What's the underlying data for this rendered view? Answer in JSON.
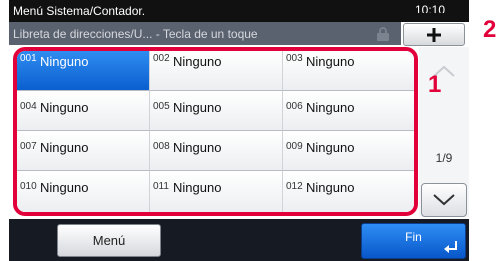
{
  "header": {
    "title": "Menú Sistema/Contador.",
    "clock": "10:10",
    "subtitle": "Libreta de direcciones/U... - Tecla de un toque"
  },
  "toolbar": {
    "add_label": "+"
  },
  "entries": [
    {
      "num": "001",
      "name": "Ninguno"
    },
    {
      "num": "002",
      "name": "Ninguno"
    },
    {
      "num": "003",
      "name": "Ninguno"
    },
    {
      "num": "004",
      "name": "Ninguno"
    },
    {
      "num": "005",
      "name": "Ninguno"
    },
    {
      "num": "006",
      "name": "Ninguno"
    },
    {
      "num": "007",
      "name": "Ninguno"
    },
    {
      "num": "008",
      "name": "Ninguno"
    },
    {
      "num": "009",
      "name": "Ninguno"
    },
    {
      "num": "010",
      "name": "Ninguno"
    },
    {
      "num": "011",
      "name": "Ninguno"
    },
    {
      "num": "012",
      "name": "Ninguno"
    }
  ],
  "pager": {
    "page": "1/9"
  },
  "footer": {
    "menu_label": "Menú",
    "fin_label": "Fin"
  },
  "callouts": {
    "one": "1",
    "two": "2"
  },
  "colors": {
    "accent": "#e2003a",
    "selected": "#1a74e0"
  },
  "icons": {
    "lock": "lock-icon",
    "add": "plus-icon",
    "up": "chevron-up-icon",
    "down": "chevron-down-icon",
    "enter": "enter-icon"
  }
}
